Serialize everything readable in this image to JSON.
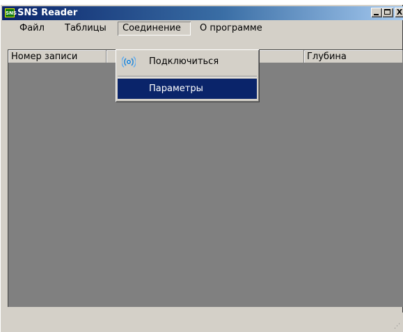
{
  "window": {
    "title": "SNS Reader",
    "icon_text": "SNS",
    "controls": {
      "minimize": "",
      "maximize": "",
      "close": "X"
    }
  },
  "menu": {
    "items": [
      "Файл",
      "Таблицы",
      "Соединение",
      "О программе"
    ],
    "open_menu": "Соединение"
  },
  "dropdown": {
    "items": [
      {
        "label": "Подключиться",
        "icon": "wireless-signal-icon"
      },
      {
        "label": "Параметры",
        "icon": "",
        "selected": true
      }
    ]
  },
  "table": {
    "columns": [
      "Номер записи",
      "",
      "Глубина"
    ],
    "rows": []
  },
  "statusbar": {
    "text": ""
  },
  "colors": {
    "titlebar_start": "#0a246a",
    "titlebar_end": "#a6caf0",
    "selection": "#0a246a",
    "list_background": "#808080",
    "chrome": "#d4d0c8"
  }
}
